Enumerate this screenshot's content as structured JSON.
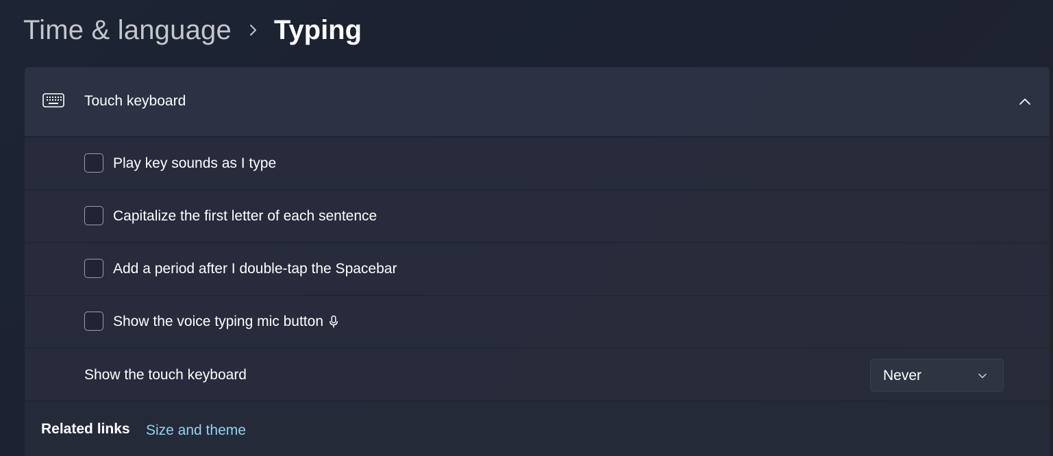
{
  "breadcrumb": {
    "parent": "Time & language",
    "current": "Typing"
  },
  "section": {
    "title": "Touch keyboard",
    "icon": "keyboard-icon",
    "expanded": true
  },
  "options": [
    {
      "label": "Play key sounds as I type",
      "checked": false
    },
    {
      "label": "Capitalize the first letter of each sentence",
      "checked": false
    },
    {
      "label": "Add a period after I double-tap the Spacebar",
      "checked": false
    },
    {
      "label": "Show the voice typing mic button",
      "checked": false,
      "trailing_icon": "microphone-icon"
    }
  ],
  "show_keyboard": {
    "label": "Show the touch keyboard",
    "selected": "Never"
  },
  "related": {
    "title": "Related links",
    "link": "Size and theme"
  },
  "colors": {
    "link": "#8fd5f2",
    "background": "#1d2433",
    "card": "#2e3444"
  }
}
